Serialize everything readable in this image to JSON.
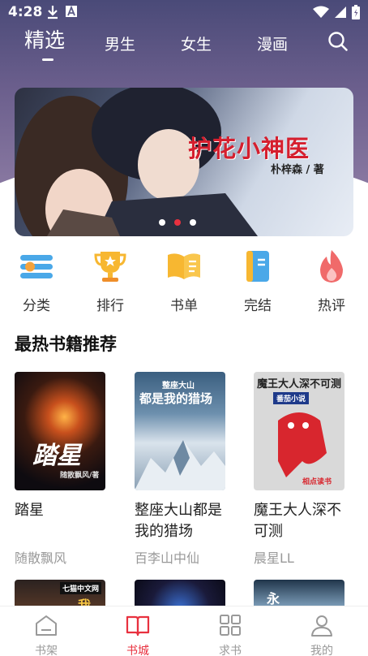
{
  "status": {
    "time": "4:28"
  },
  "topnav": {
    "tabs": [
      {
        "label": "精选",
        "active": true
      },
      {
        "label": "男生",
        "active": false
      },
      {
        "label": "女生",
        "active": false
      },
      {
        "label": "漫画",
        "active": false
      }
    ],
    "search_icon": "search-icon"
  },
  "banner": {
    "title": "护花小神医",
    "author": "朴梓森 / 著",
    "slide_count": 3,
    "active_slide": 2
  },
  "shortcuts": [
    {
      "label": "分类",
      "icon": "category-icon"
    },
    {
      "label": "排行",
      "icon": "trophy-icon"
    },
    {
      "label": "书单",
      "icon": "book-list-icon"
    },
    {
      "label": "完结",
      "icon": "finished-book-icon"
    },
    {
      "label": "热评",
      "icon": "flame-icon"
    }
  ],
  "section": {
    "title": "最热书籍推荐"
  },
  "books": [
    {
      "title": "踏星",
      "author": "随散飘风",
      "cover_text": "踏星",
      "cover_sub": "随散飘风/著"
    },
    {
      "title": "整座大山都是我的猎场",
      "author": "百李山中仙",
      "cover_text": "都是我的猎场",
      "cover_top": "整座大山"
    },
    {
      "title": "魔王大人深不可测",
      "author": "晨星LL",
      "cover_text": "魔王大人深不可测",
      "cover_badge": "番茄小说",
      "cover_sub": "相点读书"
    }
  ],
  "row2_covers": [
    {
      "badge": "七猫中文网",
      "text": "我"
    },
    {
      "text": ""
    },
    {
      "text": "永"
    }
  ],
  "tabbar": [
    {
      "label": "书架",
      "icon": "bookshelf-icon",
      "active": false
    },
    {
      "label": "书城",
      "icon": "open-book-icon",
      "active": true
    },
    {
      "label": "求书",
      "icon": "grid-icon",
      "active": false
    },
    {
      "label": "我的",
      "icon": "user-icon",
      "active": false
    }
  ],
  "colors": {
    "accent": "#e8313f",
    "hero_top": "#4a4a78",
    "hero_bottom": "#9a87ad"
  }
}
